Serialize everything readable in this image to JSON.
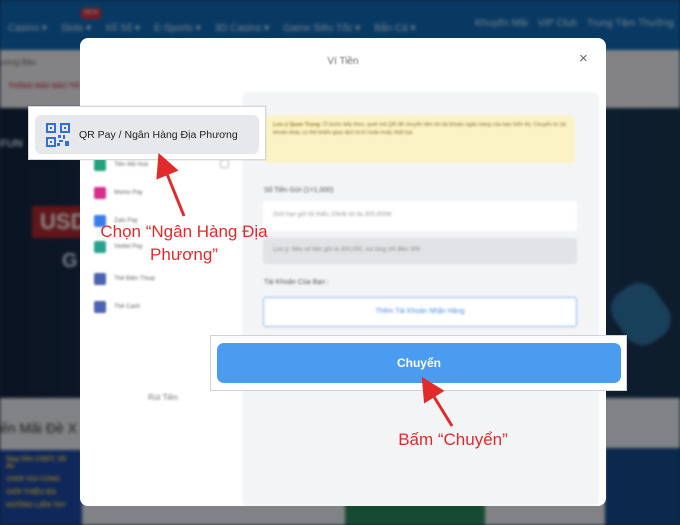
{
  "background": {
    "nav_items": [
      "Casino ▾",
      "Slots ▾",
      "Xổ Số ▾",
      "E-Sports ▾",
      "3D Casino ▾",
      "Game Siêu Tốc ▾",
      "Bắn Cá ▾"
    ],
    "nav_new_badge": "NEW",
    "nav_right": [
      "Khuyến Mãi",
      "VIP Club",
      "Trung Tâm Thưởng"
    ],
    "marquee_label": "ường Bảo",
    "marquee_text": "THÔNG BÁO BẢO TRÌ",
    "hero_line1": "FUN",
    "hero_banner": "USD",
    "hero_line2": "G",
    "promo_title": "ến Mãi Đề X",
    "promo_card_lines": [
      "Nạp tiền USDT, tối đa",
      "CHƠI VUI CÙNG",
      "GIỚI THIỆU BẠ",
      "HƯỞNG LIÊN TAY"
    ]
  },
  "modal": {
    "title": "Ví Tiền",
    "close_icon": "×",
    "payment_methods": [
      {
        "label": "Tiền Mã Hoá",
        "icon": "tether-icon",
        "color": "#26a17b"
      },
      {
        "label": "Momo Pay",
        "icon": "momo-icon",
        "color": "#d82d8b"
      },
      {
        "label": "Zalo Pay",
        "icon": "zalopay-icon",
        "color": "#3b7dea"
      },
      {
        "label": "Viettel Pay",
        "icon": "viettelpay-icon",
        "color": "#29a38f"
      },
      {
        "label": "Thẻ Điện Thoại",
        "icon": "phonecard-icon",
        "color": "#4c62b3"
      },
      {
        "label": "Thẻ Cash",
        "icon": "cashcard-icon",
        "color": "#4c62b3"
      }
    ],
    "withdraw_tab": "Rút Tiền",
    "notice_title": "Lưu ý Quan Trọng:",
    "notice_text": "Ở bước tiếp theo, quét mã QR để chuyển tiền tới tài khoản ngân hàng của bạn hiển thị. Chuyển từ tài khoản khác có thể khiến giao dịch bị trì hoãn hoặc thất bại.",
    "amount_label": "Số Tiền Gửi (1=1,000)",
    "amount_placeholder": "Giới hạn gửi tối thiểu 10k/lệ tối đa 300,000M",
    "amount_hint": "Lưu ý: Nếu số tiền gửi là 300,000, vui lòng chỉ điền 300",
    "account_label": "Tài Khoản Của Bạn :",
    "add_account_button": "Thêm Tài Khoản Nhận Hàng"
  },
  "highlight": {
    "qr_method_label": "QR Pay / Ngân Hàng Địa Phương",
    "submit_button": "Chuyển"
  },
  "annotations": {
    "choose_text": "Chọn “Ngân Hàng Địa Phương”",
    "press_text": "Bấm “Chuyển”",
    "color": "#e12b2b"
  }
}
